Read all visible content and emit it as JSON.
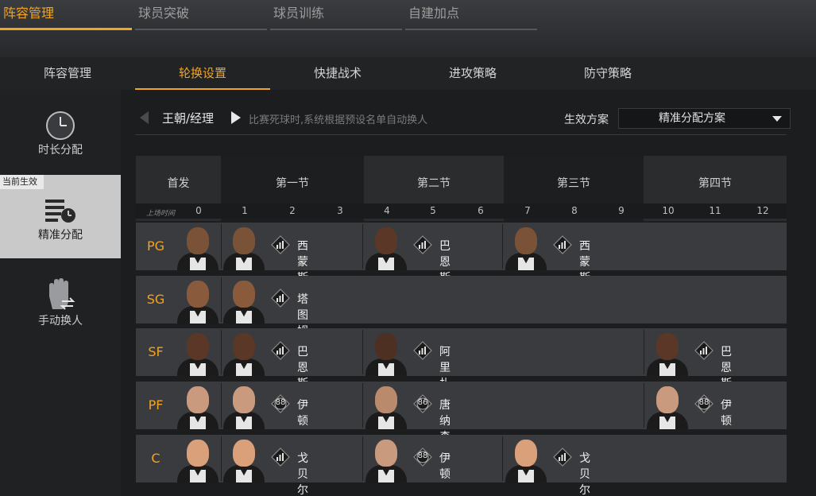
{
  "top_tabs": [
    "阵容管理",
    "球员突破",
    "球员训练",
    "自建加点"
  ],
  "sub_tabs": [
    "阵容管理",
    "轮换设置",
    "快捷战术",
    "进攻策略",
    "防守策略"
  ],
  "sidebar": {
    "badge": "当前生效",
    "items": [
      {
        "label": "时长分配",
        "icon": "clock-icon"
      },
      {
        "label": "精准分配",
        "icon": "list-clock-icon"
      },
      {
        "label": "手动换人",
        "icon": "hand-swap-icon"
      }
    ]
  },
  "header": {
    "title": "王朝/经理",
    "hint": "比赛死球时,系统根据预设名单自动换人",
    "plan_label": "生效方案",
    "plan_value": "精准分配方案"
  },
  "grid": {
    "starter_header": "首发",
    "quarters": [
      "第一节",
      "第二节",
      "第三节",
      "第四节"
    ],
    "minute_label": "上场时间",
    "minutes": [
      "0",
      "1",
      "2",
      "3",
      "4",
      "5",
      "6",
      "7",
      "8",
      "9",
      "10",
      "11",
      "12"
    ]
  },
  "rows": [
    {
      "pos": "PG",
      "starter_skin": "#7a5238",
      "segments": [
        {
          "name": "西蒙斯",
          "badge": "bars",
          "skin": "#7a5238"
        },
        {
          "name": "巴恩斯",
          "badge": "bars",
          "skin": "#5a3726"
        },
        {
          "name": "西蒙斯",
          "badge": "bars",
          "skin": "#7a5238"
        }
      ]
    },
    {
      "pos": "SG",
      "starter_skin": "#8a5a3c",
      "segments": [
        {
          "name": "塔图姆",
          "badge": "bars",
          "skin": "#8a5a3c"
        }
      ]
    },
    {
      "pos": "SF",
      "starter_skin": "#5a3726",
      "segments": [
        {
          "name": "巴恩斯",
          "badge": "bars",
          "skin": "#5a3726"
        },
        {
          "name": "阿里扎",
          "badge": "bars",
          "skin": "#4e3022"
        },
        {
          "name": "巴恩斯",
          "badge": "bars",
          "skin": "#5a3726"
        }
      ]
    },
    {
      "pos": "PF",
      "starter_skin": "#c99a7e",
      "segments": [
        {
          "name": "伊顿",
          "badge": "88",
          "skin": "#c99a7e"
        },
        {
          "name": "唐纳森",
          "badge": "86",
          "skin": "#b98a6c"
        },
        {
          "name": "伊顿",
          "badge": "88",
          "skin": "#c99a7e"
        }
      ]
    },
    {
      "pos": "C",
      "starter_skin": "#d9a07a",
      "segments": [
        {
          "name": "戈贝尔",
          "badge": "bars",
          "skin": "#d9a07a"
        },
        {
          "name": "伊顿",
          "badge": "88",
          "skin": "#c99a7e"
        },
        {
          "name": "戈贝尔",
          "badge": "bars",
          "skin": "#d9a07a"
        }
      ]
    }
  ],
  "colors": {
    "accent": "#f2a423",
    "active_side": "#c9c9c9"
  }
}
